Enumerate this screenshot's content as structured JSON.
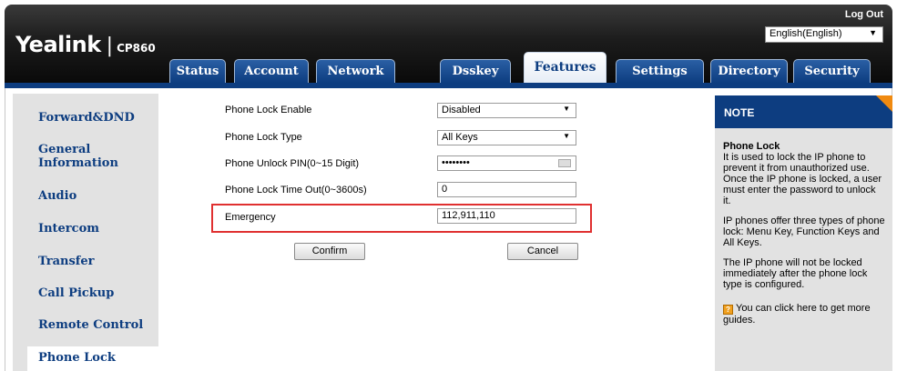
{
  "header": {
    "brand": "Yealink",
    "model": "CP860",
    "logout_label": "Log Out",
    "language": "English(English)"
  },
  "tabs": [
    {
      "label": "Status"
    },
    {
      "label": "Account"
    },
    {
      "label": "Network"
    },
    {
      "label": "Dsskey"
    },
    {
      "label": "Features",
      "active": true
    },
    {
      "label": "Settings"
    },
    {
      "label": "Directory"
    },
    {
      "label": "Security"
    }
  ],
  "sidebar": {
    "items": [
      {
        "label": "Forward&DND"
      },
      {
        "label": "General\nInformation"
      },
      {
        "label": "Audio"
      },
      {
        "label": "Intercom"
      },
      {
        "label": "Transfer"
      },
      {
        "label": "Call Pickup"
      },
      {
        "label": "Remote Control"
      },
      {
        "label": "Phone Lock",
        "active": true
      }
    ]
  },
  "form": {
    "phone_lock_enable": {
      "label": "Phone Lock Enable",
      "value": "Disabled"
    },
    "phone_lock_type": {
      "label": "Phone Lock Type",
      "value": "All Keys"
    },
    "unlock_pin": {
      "label": "Phone Unlock PIN(0~15 Digit)",
      "value": "••••••••"
    },
    "lock_timeout": {
      "label": "Phone Lock Time Out(0~3600s)",
      "value": "0"
    },
    "emergency": {
      "label": "Emergency",
      "value": "112,911,110"
    },
    "confirm_label": "Confirm",
    "cancel_label": "Cancel"
  },
  "note": {
    "heading": "NOTE",
    "title": "Phone Lock",
    "p1": "It is used to lock the IP phone to prevent it from unauthorized use. Once the IP phone is locked, a user must enter the password to unlock it.",
    "p2": "IP phones offer three types of phone lock: Menu Key, Function Keys and All Keys.",
    "p3": "The IP phone will not be locked immediately after the phone lock type is configured.",
    "guide_text": "You can click here to get more guides.",
    "guide_icon": "?"
  },
  "colors": {
    "brand_blue": "#0d3d80",
    "highlight_red": "#e03030",
    "note_accent": "#f08a10"
  }
}
